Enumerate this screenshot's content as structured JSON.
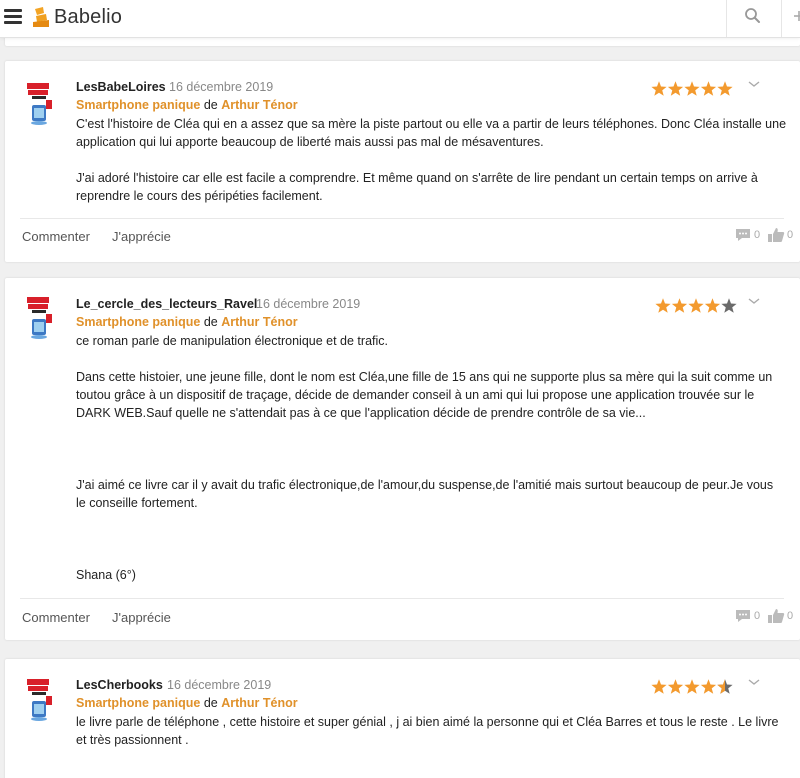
{
  "header": {
    "logo_text": "Babelio",
    "menu_icon": "hamburger-icon",
    "search_icon": "search-icon",
    "brand_color": "#f0a020"
  },
  "reviews": [
    {
      "user": "LesBabeLoires",
      "date": "16 décembre 2019",
      "book_title": "Smartphone panique",
      "by": "de",
      "author": "Arthur Ténor",
      "rating": 5,
      "rating_max": 5,
      "body": [
        "C'est l'histoire de Cléa qui en a assez que sa mère la piste partout ou elle va a partir de leurs téléphones. Donc Cléa installe une",
        "application qui lui apporte beaucoup de liberté mais aussi pas mal de mésaventures.",
        "",
        "J'ai adoré l'histoire car elle est facile a comprendre. Et même quand on s'arrête de lire pendant un certain temps on arrive à",
        "reprendre le cours des péripéties facilement."
      ],
      "comment_label": "Commenter",
      "like_label": "J'apprécie",
      "comments_count": "0",
      "likes_count": "0"
    },
    {
      "user": "Le_cercle_des_lecteurs_Ravel",
      "date": "16 décembre 2019",
      "book_title": "Smartphone panique",
      "by": "de",
      "author": "Arthur Ténor",
      "rating": 4,
      "rating_max": 5,
      "body": [
        "ce roman parle de manipulation électronique et de trafic.",
        "",
        "Dans cette histoier, une jeune fille, dont le nom est Cléa,une fille de 15 ans qui ne supporte plus sa mère qui la suit comme un",
        "toutou grâce à un dispositif de traçage, décide de demander conseil à un ami qui lui propose une application trouvée sur le",
        "DARK WEB.Sauf quelle ne s'attendait pas à ce que l'application décide de prendre contrôle de sa vie...",
        "",
        "",
        "",
        "J'ai aimé ce livre car il y avait du trafic électronique,de l'amour,du suspense,de l'amitié mais surtout beaucoup de peur.Je vous",
        "le conseille fortement.",
        "",
        "",
        "",
        "Shana (6°)"
      ],
      "comment_label": "Commenter",
      "like_label": "J'apprécie",
      "comments_count": "0",
      "likes_count": "0"
    },
    {
      "user": "LesCherbooks",
      "date": "16 décembre 2019",
      "book_title": "Smartphone panique",
      "by": "de",
      "author": "Arthur Ténor",
      "rating": 4.5,
      "rating_max": 5,
      "body": [
        "le livre parle de téléphone , cette histoire et super génial , j ai bien aimé la personne qui et Cléa Barres et tous le reste . Le livre",
        "et très passionnent ."
      ],
      "comment_label": "",
      "like_label": "",
      "comments_count": "",
      "likes_count": ""
    }
  ],
  "colors": {
    "accent": "#e0912a",
    "star": "#f39a2e",
    "star_empty": "#6b6b6b"
  }
}
